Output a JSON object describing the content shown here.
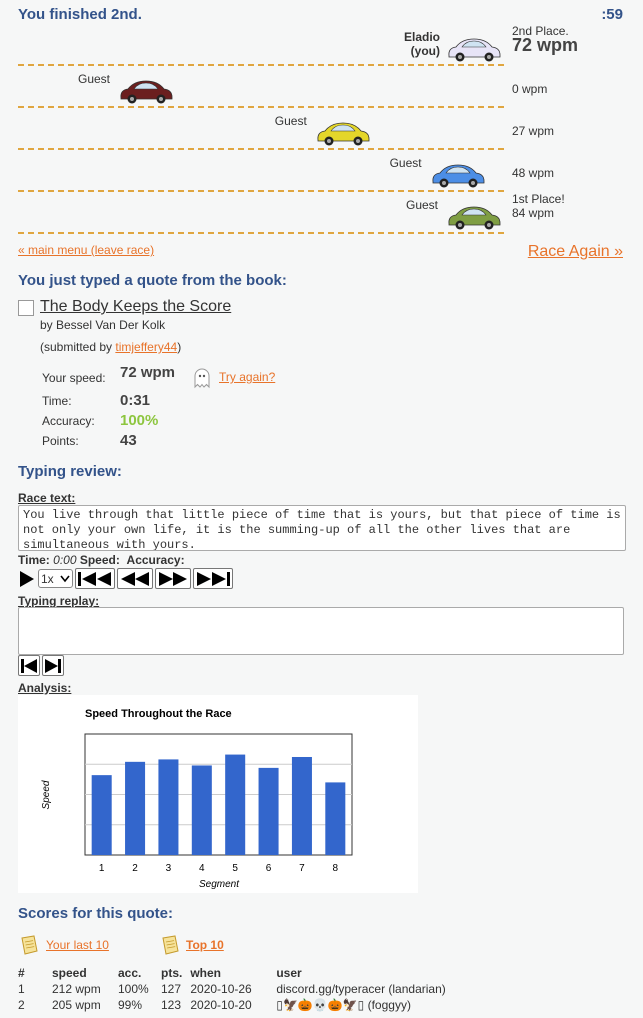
{
  "header": {
    "result": "You finished 2nd.",
    "timer": ":59"
  },
  "racers": [
    {
      "name": "Eladio",
      "name2": "(you)",
      "stat_line1": "2nd Place.",
      "wpm": "72 wpm",
      "car_color": "#e7e4f7",
      "progress": 1.0
    },
    {
      "name": "Guest",
      "stat_line1": "0 wpm",
      "car_color": "#6b1f1f",
      "progress": 0.0
    },
    {
      "name": "Guest",
      "stat_line1": "27 wpm",
      "car_color": "#e4d62a",
      "progress": 0.6
    },
    {
      "name": "Guest",
      "stat_line1": "48 wpm",
      "car_color": "#4c8ee6",
      "progress": 0.95
    },
    {
      "name": "Guest",
      "stat_line1": "1st Place!",
      "stat_line2": "84 wpm",
      "car_color": "#7f9e43",
      "progress": 1.0
    }
  ],
  "nav": {
    "main_menu": "« main menu (leave race)",
    "race_again": "Race Again »"
  },
  "quote": {
    "heading": "You just typed a quote from the book:",
    "title": "The Body Keeps the Score",
    "author": "by Bessel Van Der Kolk",
    "submitted_prefix": "(submitted by ",
    "submitted_user": "timjeffery44",
    "submitted_suffix": ")"
  },
  "stats": {
    "speed_label": "Your speed:",
    "speed": "72 wpm",
    "try_again": "Try again?",
    "time_label": "Time:",
    "time": "0:31",
    "accuracy_label": "Accuracy:",
    "accuracy": "100%",
    "points_label": "Points:",
    "points": "43"
  },
  "review": {
    "heading": "Typing review:",
    "race_text_label": "Race text:",
    "race_text": "You live through that little piece of time that is yours, but that piece of time is not only your own life, it is the summing-up of all the other lives that are simultaneous with yours.",
    "time_label": "Time:",
    "time_value": "0:00",
    "speed_label": "Speed:",
    "accuracy_label": "Accuracy:",
    "speed_select": "1x",
    "replay_label": "Typing replay:",
    "analysis_label": "Analysis:"
  },
  "chart_data": {
    "type": "bar",
    "title": "Speed Throughout the Race",
    "xlabel": "Segment",
    "ylabel": "Speed",
    "categories": [
      "1",
      "2",
      "3",
      "4",
      "5",
      "6",
      "7",
      "8"
    ],
    "values": [
      66,
      77,
      79,
      74,
      83,
      72,
      81,
      60
    ],
    "ylim": [
      0,
      100
    ],
    "grid": true,
    "color": "#3366cc"
  },
  "scores": {
    "heading": "Scores for this quote:",
    "tabs": [
      "Your last 10",
      "Top 10"
    ],
    "columns": [
      "#",
      "speed",
      "acc.",
      "pts.",
      "when",
      "user"
    ],
    "rows": [
      [
        "1",
        "212 wpm",
        "100%",
        "127",
        "2020-10-26",
        "discord.gg/typeracer (landarian)"
      ],
      [
        "2",
        "205 wpm",
        "99%",
        "123",
        "2020-10-20",
        "▯🦅🎃💀🎃🦅▯ (foggyy)"
      ]
    ]
  }
}
